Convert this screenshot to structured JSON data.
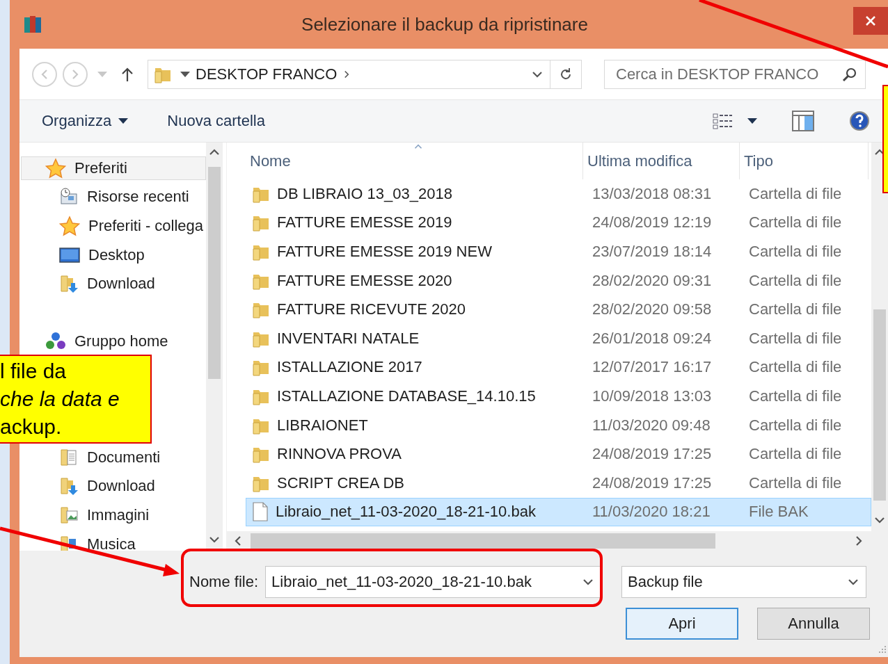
{
  "window": {
    "title": "Selezionare il backup da ripristinare"
  },
  "nav": {
    "back_disabled": true,
    "forward_disabled": true
  },
  "address_bar": {
    "path": [
      "DESKTOP FRANCO"
    ]
  },
  "search": {
    "placeholder": "Cerca in DESKTOP FRANCO"
  },
  "toolbar": {
    "items": [
      {
        "label": "Organizza",
        "kind": "menu"
      },
      {
        "label": "Nuova cartella",
        "kind": "button"
      }
    ]
  },
  "sidebar": {
    "tree": [
      {
        "label": "Preferiti",
        "kind": "star",
        "selected": true,
        "children": [
          {
            "label": "Risorse recenti",
            "kind": "recent",
            "selected": false
          },
          {
            "label": "Preferiti - collega",
            "kind": "star",
            "selected": false
          },
          {
            "label": "Desktop",
            "kind": "desktop",
            "selected": false
          },
          {
            "label": "Download",
            "kind": "download",
            "selected": false
          }
        ]
      },
      {
        "label": "Gruppo home",
        "kind": "homegroup",
        "selected": false
      }
    ],
    "library_items": [
      {
        "label": "Documenti",
        "kind": "documents",
        "selected": false
      },
      {
        "label": "Download",
        "kind": "download",
        "selected": false
      },
      {
        "label": "Immagini",
        "kind": "images",
        "selected": false
      },
      {
        "label": "Musica",
        "kind": "music",
        "selected": false
      }
    ]
  },
  "file_list": {
    "columns": [
      {
        "label": "Nome",
        "sorted": true
      },
      {
        "label": "Ultima modifica",
        "sorted": false
      },
      {
        "label": "Tipo",
        "sorted": false
      }
    ],
    "rows": [
      {
        "kind": "folder",
        "name": "DB LIBRAIO 13_03_2018",
        "modified": "13/03/2018 08:31",
        "type": "Cartella di file",
        "selected": false
      },
      {
        "kind": "folder",
        "name": "FATTURE EMESSE 2019",
        "modified": "24/08/2019 12:19",
        "type": "Cartella di file",
        "selected": false
      },
      {
        "kind": "folder",
        "name": "FATTURE EMESSE 2019 NEW",
        "modified": "23/07/2019 18:14",
        "type": "Cartella di file",
        "selected": false
      },
      {
        "kind": "folder",
        "name": "FATTURE EMESSE 2020",
        "modified": "28/02/2020 09:31",
        "type": "Cartella di file",
        "selected": false
      },
      {
        "kind": "folder",
        "name": "FATTURE RICEVUTE 2020",
        "modified": "28/02/2020 09:58",
        "type": "Cartella di file",
        "selected": false
      },
      {
        "kind": "folder",
        "name": "INVENTARI NATALE",
        "modified": "26/01/2018 09:24",
        "type": "Cartella di file",
        "selected": false
      },
      {
        "kind": "folder",
        "name": "ISTALLAZIONE 2017",
        "modified": "12/07/2017 16:17",
        "type": "Cartella di file",
        "selected": false
      },
      {
        "kind": "folder",
        "name": "ISTALLAZIONE DATABASE_14.10.15",
        "modified": "10/09/2018 13:03",
        "type": "Cartella di file",
        "selected": false
      },
      {
        "kind": "folder",
        "name": "LIBRAIONET",
        "modified": "11/03/2020 09:48",
        "type": "Cartella di file",
        "selected": false
      },
      {
        "kind": "folder",
        "name": "RINNOVA PROVA",
        "modified": "24/08/2019 17:25",
        "type": "Cartella di file",
        "selected": false
      },
      {
        "kind": "folder",
        "name": "SCRIPT CREA DB",
        "modified": "24/08/2019 17:25",
        "type": "Cartella di file",
        "selected": false
      },
      {
        "kind": "file",
        "name": "Libraio_net_11-03-2020_18-21-10.bak",
        "modified": "11/03/2020 18:21",
        "type": "File BAK",
        "selected": true
      }
    ]
  },
  "file_name": {
    "label": "Nome file:",
    "value": "Libraio_net_11-03-2020_18-21-10.bak"
  },
  "file_type": {
    "value": "Backup file"
  },
  "buttons": [
    {
      "label": "Apri",
      "default": true
    },
    {
      "label": "Annulla",
      "default": false
    }
  ],
  "annotation": {
    "callout_lines": [
      "l file da",
      "*che la data e*",
      "ackup."
    ]
  }
}
